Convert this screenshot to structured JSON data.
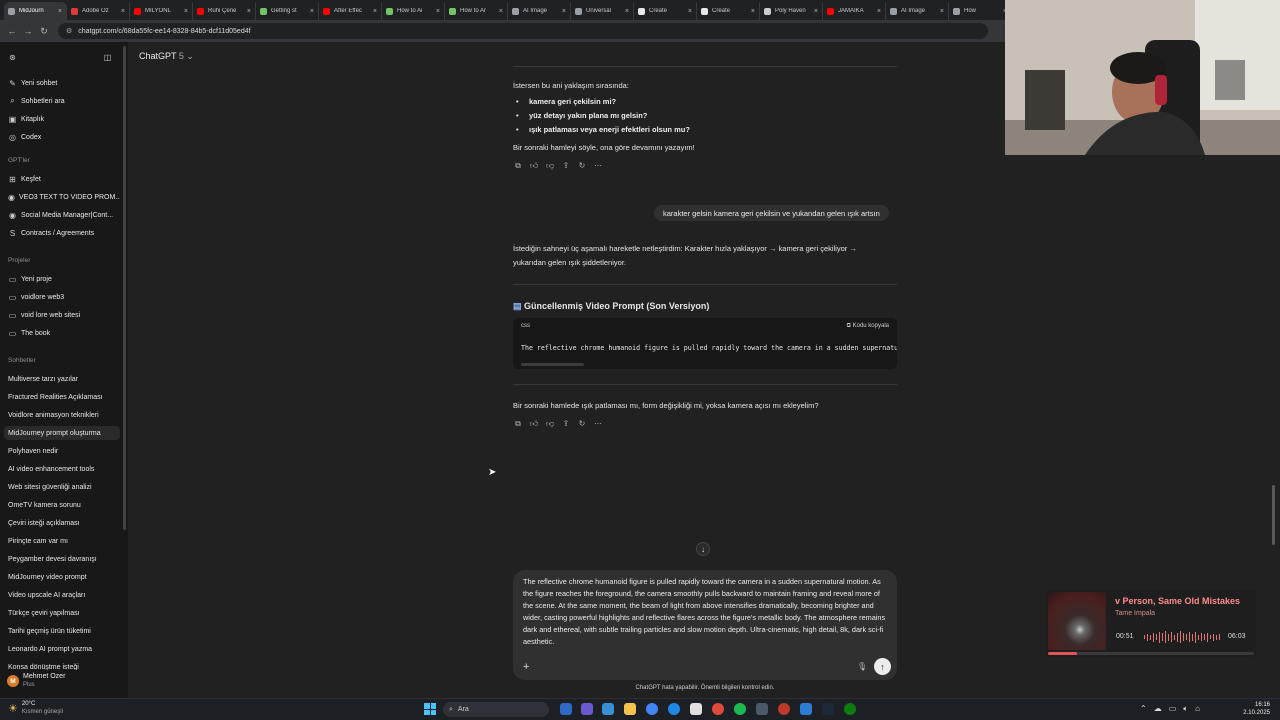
{
  "browser": {
    "tabs": [
      {
        "label": "MidJourn",
        "color": "#9aa0a6",
        "active": true
      },
      {
        "label": "Adobe Öz",
        "color": "#e03a3a"
      },
      {
        "label": "MİLYONL",
        "color": "#ff0000"
      },
      {
        "label": "Ruhi Çene",
        "color": "#ff0000"
      },
      {
        "label": "Getting st",
        "color": "#74c365"
      },
      {
        "label": "After Effec",
        "color": "#ff0000"
      },
      {
        "label": "How to Ai",
        "color": "#74c365"
      },
      {
        "label": "How to Ar",
        "color": "#74c365"
      },
      {
        "label": "AI Image",
        "color": "#9aa0a6"
      },
      {
        "label": "Universal",
        "color": "#9aa0a6"
      },
      {
        "label": "Create",
        "color": "#e8e8e8"
      },
      {
        "label": "Create",
        "color": "#e8e8e8"
      },
      {
        "label": "Poly Haven",
        "color": "#cccccc"
      },
      {
        "label": "JAMAİKA",
        "color": "#ff0000"
      },
      {
        "label": "AI Image",
        "color": "#9aa0a6"
      },
      {
        "label": "How",
        "color": "#9aa0a6"
      }
    ],
    "url": "chatgpt.com/c/68da55fc-ee14-8328-84b5-dcf11d05ed4f"
  },
  "sidebar": {
    "top_items": [
      {
        "label": "Yeni sohbet",
        "icon": "compose-icon",
        "glyph": "✎"
      },
      {
        "label": "Sohbetleri ara",
        "icon": "search-icon",
        "glyph": "⌕"
      },
      {
        "label": "Kitaplık",
        "icon": "library-icon",
        "glyph": "▣"
      },
      {
        "label": "Codex",
        "icon": "codex-icon",
        "glyph": "◎"
      }
    ],
    "gpts_header": "GPT'ler",
    "gpts": [
      {
        "label": "Keşfet",
        "icon": "explore-icon",
        "glyph": "⊞"
      },
      {
        "label": "VEO3 TEXT TO VIDEO PROM...",
        "icon": "gpt-veo3-icon",
        "glyph": "◉"
      },
      {
        "label": "Social Media Manager|Cont...",
        "icon": "gpt-social-icon",
        "glyph": "◉"
      },
      {
        "label": "Contracts / Agreements",
        "icon": "gpt-contracts-icon",
        "glyph": "S"
      }
    ],
    "projects_header": "Projeler",
    "projects": [
      {
        "label": "Yeni proje",
        "icon": "new-folder-icon",
        "glyph": "▭"
      },
      {
        "label": "voidlore web3",
        "icon": "folder-icon",
        "glyph": "▭"
      },
      {
        "label": "void lore web sitesi",
        "icon": "folder-icon",
        "glyph": "▭"
      },
      {
        "label": "The book",
        "icon": "folder-icon",
        "glyph": "▭"
      }
    ],
    "chats_header": "Sohbetler",
    "chats": [
      "Multiverse tarzı yazılar",
      "Fractured Realities Açıklaması",
      "Voidlore animasyon teknikleri",
      "MidJourney prompt oluşturma",
      "Polyhaven nedir",
      "AI video enhancement tools",
      "Web sitesi güvenliği analizi",
      "OmeTV kamera sorunu",
      "Çeviri isteği açıklaması",
      "Pirinçte cam var mı",
      "Peygamber devesi davranışı",
      "MidJourney video prompt",
      "Video upscale AI araçları",
      "Türkçe çeviri yapılması",
      "Tarihi geçmiş ürün tüketimi",
      "Leonardo AI prompt yazma",
      "Konsa dönüştme isteği"
    ],
    "selected_chat": 3,
    "user": {
      "initials": "M",
      "name": "Mehmet Ozer",
      "plan": "Plus"
    }
  },
  "chat": {
    "model": "ChatGPT",
    "model_version": "5",
    "intro_line": "İstersen bu ani yaklaşım sırasında:",
    "bullets": [
      "kamera geri çekilsin mi?",
      "yüz detayı yakın plana mı gelsin?",
      "ışık patlaması veya enerji efektleri olsun mu?"
    ],
    "next_move_line": "Bir sonraki hamleyi söyle, ona göre devamını yazayım!",
    "user_message": "karakter gelsin kamera geri çekilsin ve yukandan gelen ışık artsın",
    "reply_line1": "İstediğin sahneyi üç aşamalı hareketle netleştirdim: Karakter hızla yaklaşıyor → kamera geri çekiliyor →",
    "reply_line2": "yukarıdan gelen ışık şiddetleniyor.",
    "section_title": "Güncellenmiş Video Prompt (Son Versiyon)",
    "code_lang": "css",
    "copy_label": "Kodu kopyala",
    "code_text": "The reflective chrome humanoid figure is pulled rapidly toward the camera in a sudden supernatural",
    "followup_question": "Bir sonraki hamlede ışık patlaması mı, form değişikliği mi, yoksa kamera açısı mı ekleyelim?",
    "composer_text": "The reflective chrome humanoid figure is pulled rapidly toward the camera in a sudden supernatural motion. As the figure reaches the foreground, the camera smoothly pulls backward to maintain framing and reveal more of the scene. At the same moment, the beam of light from above intensifies dramatically, becoming brighter and wider, casting powerful highlights and reflective flares across the figure's metallic body. The atmosphere remains dark and ethereal, with subtle trailing particles and slow motion depth. Ultra-cinematic, high detail, 8k, dark sci-fi aesthetic.",
    "disclaimer": "ChatGPT hata yapabilir. Önemli bilgileri kontrol edin."
  },
  "media_widget": {
    "song": "v Person, Same Old Mistakes",
    "artist": "Tame Impala",
    "elapsed": "00:51",
    "duration": "06:03",
    "progress": 0.14
  },
  "taskbar": {
    "temperature": "20°C",
    "weather_desc": "Kısmen güneşli",
    "search_placeholder": "Ara",
    "time": "16:16",
    "date": "2.10.2025"
  }
}
